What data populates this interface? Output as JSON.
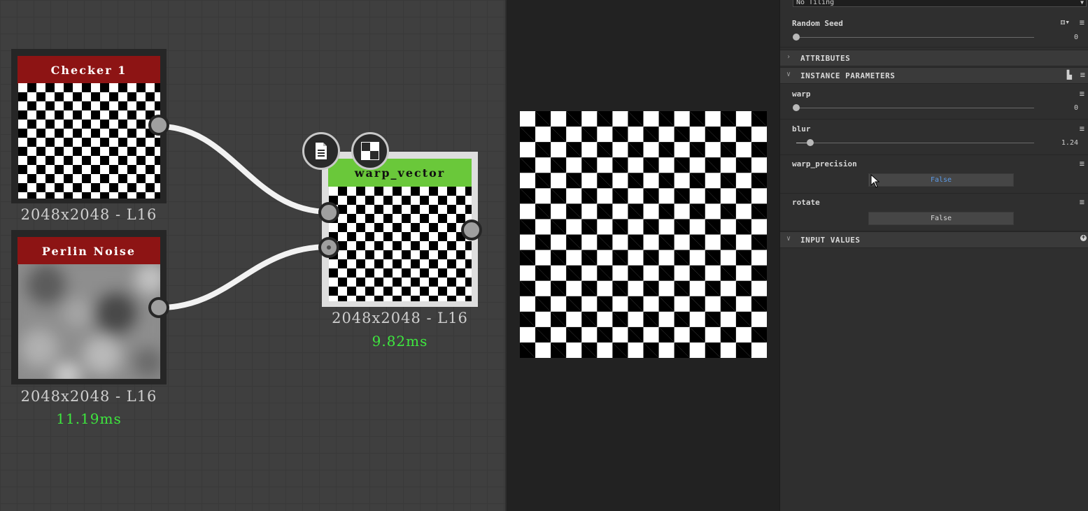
{
  "graph": {
    "nodes": [
      {
        "id": "checker",
        "title": "Checker 1",
        "resolution": "2048x2048 - L16",
        "timing": ""
      },
      {
        "id": "perlin",
        "title": "Perlin Noise",
        "resolution": "2048x2048 - L16",
        "timing": "11.19ms"
      },
      {
        "id": "warp",
        "title": "warp_vector",
        "resolution": "2048x2048 - L16",
        "timing": "9.82ms"
      }
    ],
    "colors": {
      "generator_header": "#8d1414",
      "filter_header": "#6ac83a",
      "timing": "#3ee83e"
    }
  },
  "props": {
    "tiling_value": "No Tiling",
    "random_seed": {
      "label": "Random Seed",
      "value": "0"
    },
    "sections": {
      "attributes": "ATTRIBUTES",
      "instance_parameters": "INSTANCE PARAMETERS",
      "input_values": "INPUT VALUES"
    },
    "params": {
      "warp": {
        "label": "warp",
        "value": "0",
        "fraction": 0
      },
      "blur": {
        "label": "blur",
        "value": "1.24",
        "fraction": 0.06
      },
      "warp_precision": {
        "label": "warp_precision",
        "value": "False"
      },
      "rotate": {
        "label": "rotate",
        "value": "False"
      }
    },
    "icons": [
      "menu-icon",
      "dice-icon",
      "presets-icon",
      "add-icon"
    ]
  }
}
